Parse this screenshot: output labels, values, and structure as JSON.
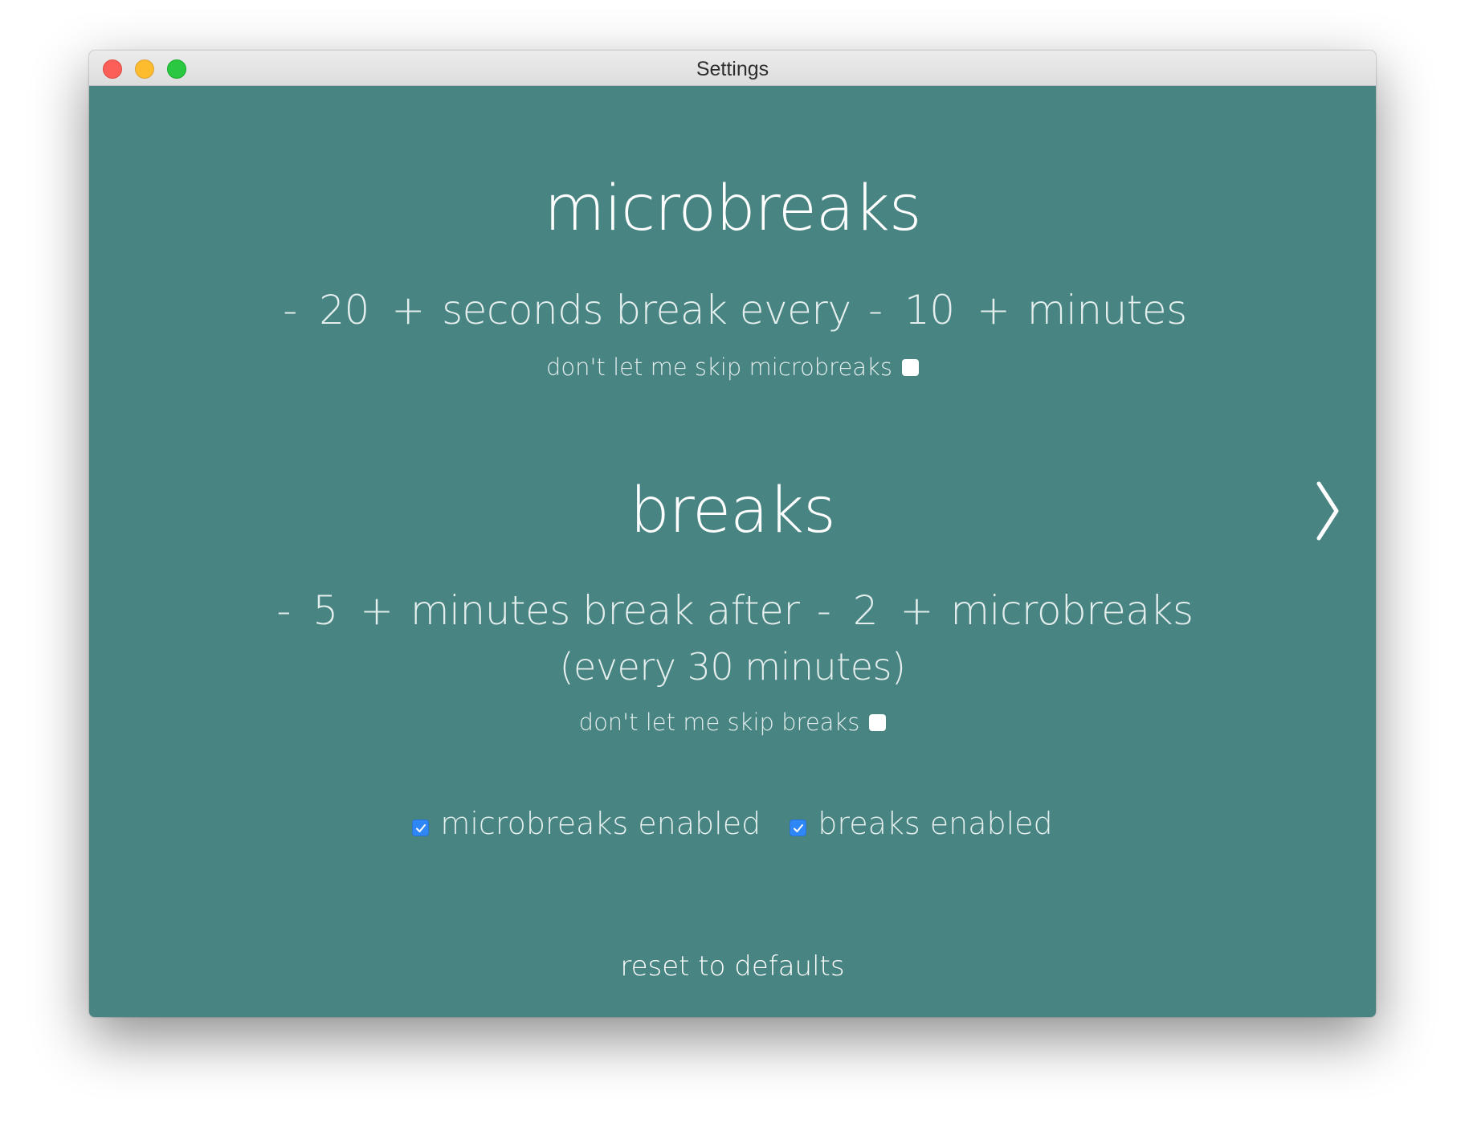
{
  "window": {
    "title": "Settings"
  },
  "microbreaks": {
    "heading": "microbreaks",
    "minus": "-",
    "plus": "+",
    "duration_value": "20",
    "duration_unit": "seconds break every",
    "interval_value": "10",
    "interval_unit": "minutes",
    "strict_label": "don't let me skip microbreaks",
    "strict_checked": false
  },
  "breaks": {
    "heading": "breaks",
    "minus": "-",
    "plus": "+",
    "duration_value": "5",
    "duration_unit": "minutes break after",
    "interval_value": "2",
    "interval_unit": "microbreaks",
    "summary": "(every 30 minutes)",
    "strict_label": "don't let me skip breaks",
    "strict_checked": false
  },
  "toggles": {
    "microbreaks_label": "microbreaks enabled",
    "microbreaks_checked": true,
    "breaks_label": "breaks enabled",
    "breaks_checked": true
  },
  "footer": {
    "reset_label": "reset to defaults"
  },
  "navigation": {
    "next_icon": "chevron-right-icon"
  },
  "colors": {
    "background": "#488482",
    "text": "#ffffff",
    "checkbox_accent": "#2f86f6"
  }
}
